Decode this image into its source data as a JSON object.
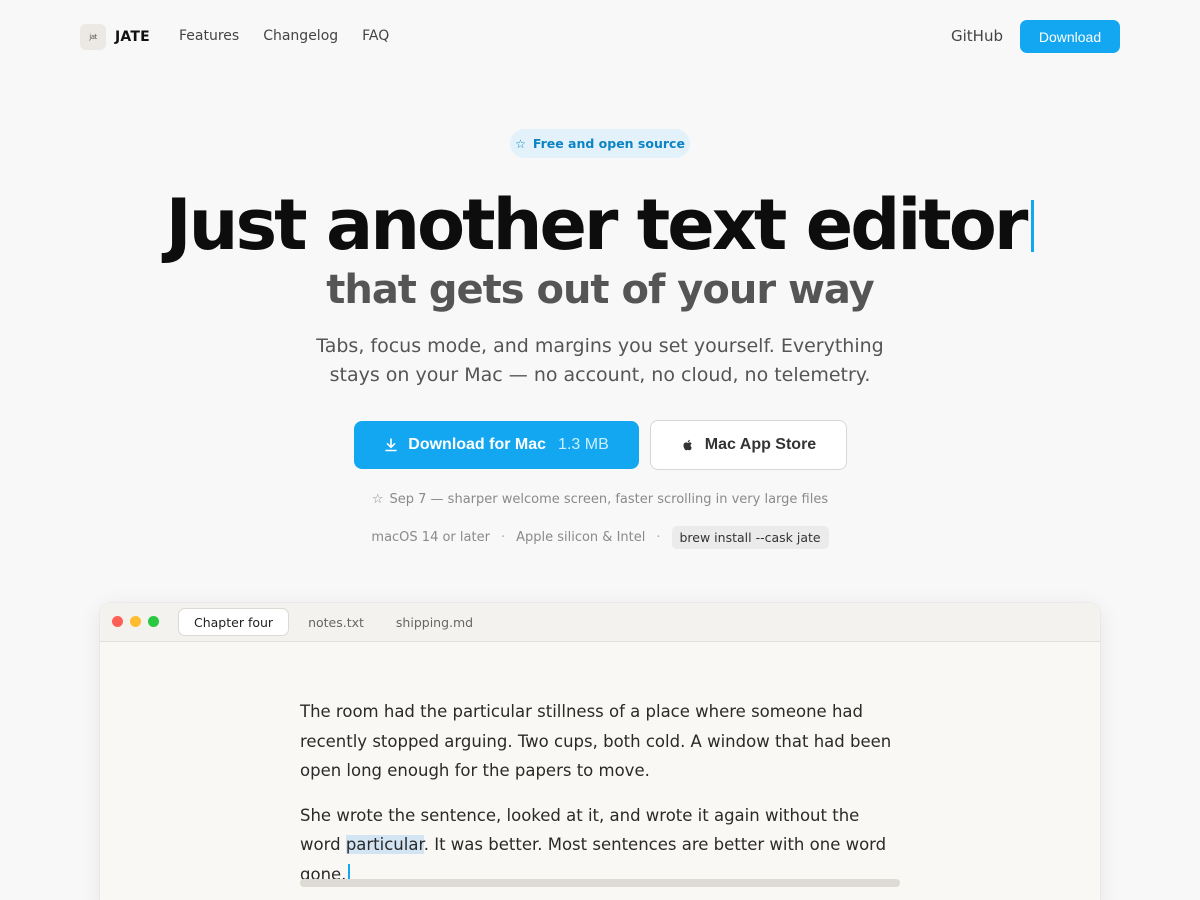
{
  "nav": {
    "logo_glyph": "jat",
    "logo_text": "JATE",
    "links": [
      "Features",
      "Changelog",
      "FAQ"
    ],
    "github": "GitHub",
    "download": "Download"
  },
  "hero": {
    "badge": "Free and open source",
    "title": "Just another text editor",
    "subtitle": "that gets out of your way",
    "lede": "Tabs, focus mode, and margins you set yourself. Everything stays on your Mac — no account, no cloud, no telemetry.",
    "primary_label": "Download for Mac",
    "primary_size": "1.3 MB",
    "secondary_label": "Mac App Store",
    "news": "Sep 7 — sharper welcome screen, faster scrolling in very large files",
    "reqs": [
      "macOS 14 or later",
      "Apple silicon & Intel"
    ],
    "separator": "·",
    "brew": "brew install --cask jate"
  },
  "editor": {
    "tabs": [
      "Chapter four",
      "notes.txt",
      "shipping.md"
    ],
    "active_tab": 0,
    "para1": "The room had the particular stillness of a place where someone had recently stopped arguing. Two cups, both cold. A window that had been open long enough for the papers to move.",
    "para2_before": "She wrote the sentence, looked at it, and wrote it again without the word ",
    "para2_highlight": "particular",
    "para2_after": ". It was better. Most sentences are better with one word gone."
  },
  "colors": {
    "accent": "#12a7f0",
    "badge_bg": "#e3f1fa",
    "page_bg": "#f8f8f8",
    "editor_bg": "#faf8f4",
    "traffic_red": "#fe5f57",
    "traffic_yellow": "#febc2e",
    "traffic_green": "#28c840"
  },
  "icons": {
    "badge": "star-outline-icon",
    "primary_button": "download-icon",
    "secondary_button": "apple-icon",
    "news": "star-outline-icon"
  }
}
